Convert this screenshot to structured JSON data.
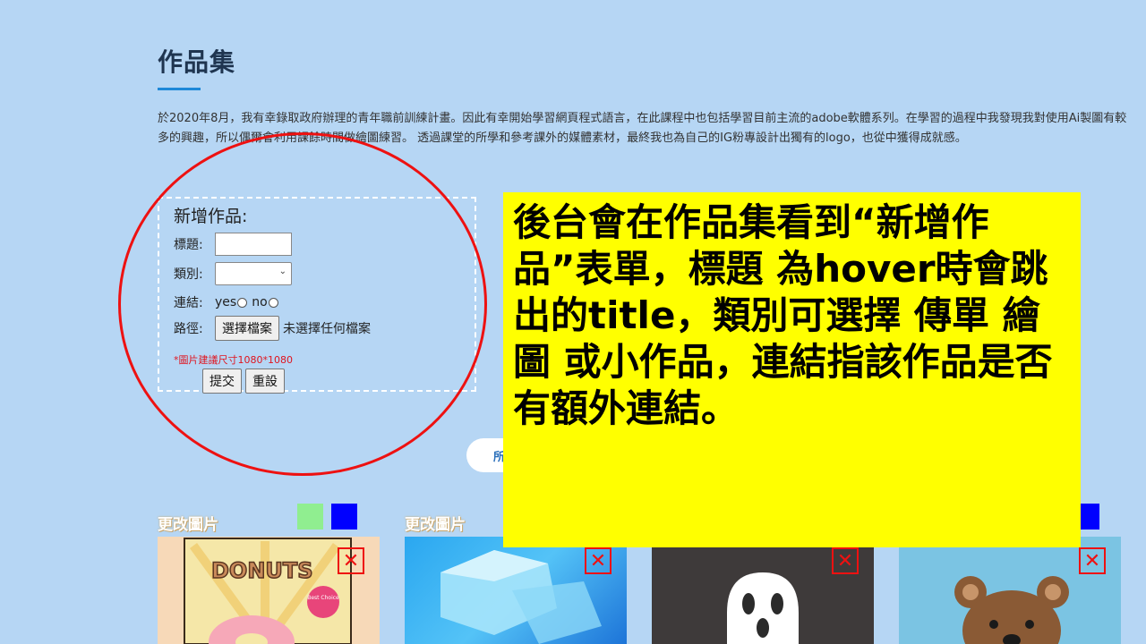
{
  "section": {
    "title": "作品集",
    "intro": "於2020年8月，我有幸錄取政府辦理的青年職前訓練計畫。因此有幸開始學習網頁程式語言，在此課程中也包括學習目前主流的adobe軟體系列。在學習的過程中我發現我對使用Ai製圖有較多的興趣，所以偶爾會利用課餘時間做繪圖練習。 透過課堂的所學和參考課外的媒體素材，最終我也為自己的IG粉專設計出獨有的logo，也從中獲得成就感。"
  },
  "form": {
    "heading": "新增作品:",
    "title_label": "標題:",
    "title_value": "",
    "category_label": "類別:",
    "category_selected": "",
    "link_label": "連結:",
    "link_yes": "yes",
    "link_no": "no",
    "path_label": "路徑:",
    "file_button": "選擇檔案",
    "file_status": "未選擇任何檔案",
    "size_hint": "*圖片建議尺寸1080*1080",
    "submit_label": "提交",
    "reset_label": "重設"
  },
  "filter": {
    "partial_label": "所"
  },
  "gallery": {
    "change_label": "更改圖片",
    "delete_symbol": "✕",
    "swatch_colors": [
      "#90ee90",
      "#0000ff"
    ],
    "cards": [
      {
        "title": "DONUTS",
        "badge": "Best Choice"
      },
      {
        "title": ""
      },
      {
        "title": ""
      },
      {
        "title": ""
      }
    ]
  },
  "callout": {
    "text": "後台會在作品集看到“新增作品”表單，標題 為hover時會跳出的title，類別可選擇 傳單 繪圖 或小作品，連結指該作品是否有額外連結。",
    "background": "#ffff00"
  },
  "colors": {
    "page_bg": "#b6d6f4",
    "accent_line": "#1e88d8",
    "annotation_red": "#ee1111"
  }
}
